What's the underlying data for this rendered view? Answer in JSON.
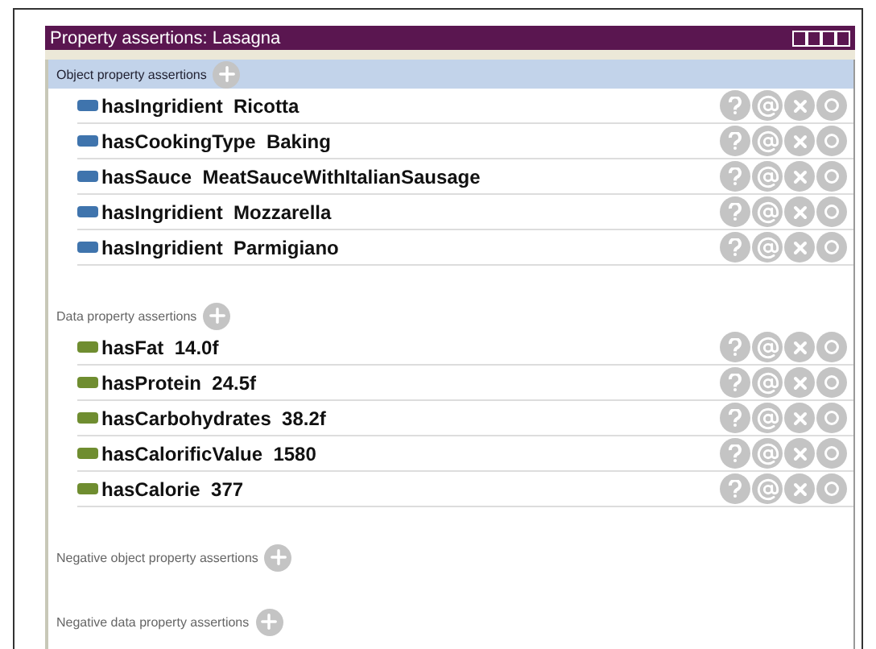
{
  "window": {
    "title": "Property assertions: Lasagna"
  },
  "sections": [
    {
      "title": "Object property assertions",
      "kind": "object",
      "highlighted": true,
      "rows": [
        {
          "property": "hasIngridient",
          "value": "Ricotta"
        },
        {
          "property": "hasCookingType",
          "value": "Baking"
        },
        {
          "property": "hasSauce",
          "value": "MeatSauceWithItalianSausage"
        },
        {
          "property": "hasIngridient",
          "value": "Mozzarella"
        },
        {
          "property": "hasIngridient",
          "value": "Parmigiano"
        }
      ]
    },
    {
      "title": "Data property assertions",
      "kind": "data",
      "highlighted": false,
      "rows": [
        {
          "property": "hasFat",
          "value": "14.0f"
        },
        {
          "property": "hasProtein",
          "value": "24.5f"
        },
        {
          "property": "hasCarbohydrates",
          "value": "38.2f"
        },
        {
          "property": "hasCalorificValue",
          "value": "1580"
        },
        {
          "property": "hasCalorie",
          "value": "377"
        }
      ]
    },
    {
      "title": "Negative object property assertions",
      "highlighted": false
    },
    {
      "title": "Negative data property assertions",
      "highlighted": false
    }
  ]
}
